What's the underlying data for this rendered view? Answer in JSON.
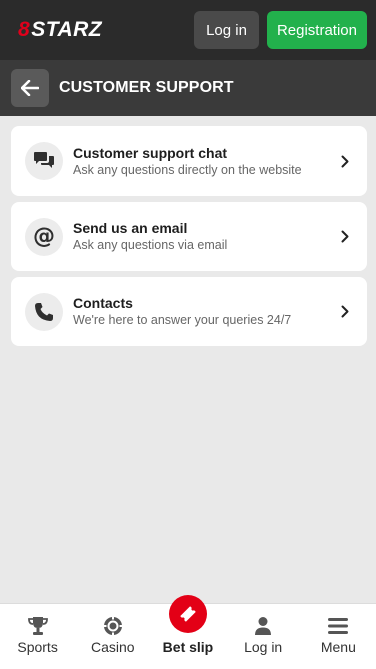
{
  "header": {
    "logo_mark": "8",
    "logo_text": "STARZ",
    "login_label": "Log in",
    "register_label": "Registration"
  },
  "subheader": {
    "title": "CUSTOMER SUPPORT"
  },
  "support": {
    "items": [
      {
        "icon": "chat-icon",
        "title": "Customer support chat",
        "subtitle": "Ask any questions directly on the website"
      },
      {
        "icon": "at-sign-icon",
        "title": "Send us an email",
        "subtitle": "Ask any questions via email"
      },
      {
        "icon": "phone-icon",
        "title": "Contacts",
        "subtitle": "We're here to answer your queries 24/7"
      }
    ]
  },
  "bottom_nav": {
    "items": [
      {
        "icon": "trophy-icon",
        "label": "Sports"
      },
      {
        "icon": "casino-chip-icon",
        "label": "Casino"
      },
      {
        "icon": "ticket-icon",
        "label": "Bet slip"
      },
      {
        "icon": "user-icon",
        "label": "Log in"
      },
      {
        "icon": "menu-icon",
        "label": "Menu"
      }
    ]
  },
  "colors": {
    "header_bg": "#2b2b2b",
    "subheader_bg": "#3a3a3a",
    "register_green": "#22b14c",
    "brand_red": "#e30016",
    "page_bg": "#e9e9e9"
  }
}
